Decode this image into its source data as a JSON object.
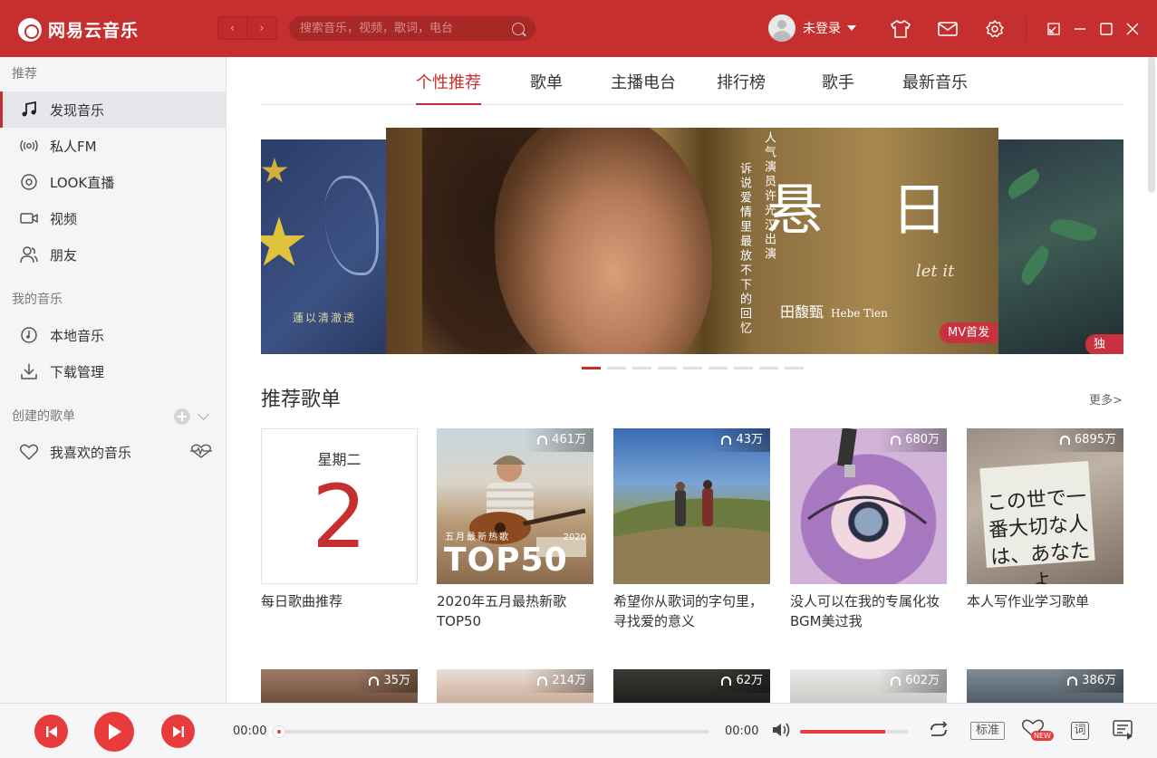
{
  "app": {
    "name": "网易云音乐"
  },
  "header": {
    "back_arrow": "‹",
    "forward_arrow": "›",
    "search_placeholder": "搜索音乐，视频，歌词，电台",
    "user_name": "未登录"
  },
  "sidebar": {
    "section1": "推荐",
    "items1": [
      {
        "label": "发现音乐",
        "icon": "music-note-icon",
        "active": true
      },
      {
        "label": "私人FM",
        "icon": "radio-waves-icon"
      },
      {
        "label": "LOOK直播",
        "icon": "live-icon"
      },
      {
        "label": "视频",
        "icon": "video-camera-icon"
      },
      {
        "label": "朋友",
        "icon": "friends-icon"
      }
    ],
    "section2": "我的音乐",
    "items2": [
      {
        "label": "本地音乐",
        "icon": "disc-icon"
      },
      {
        "label": "下载管理",
        "icon": "download-icon"
      }
    ],
    "section3": "创建的歌单",
    "items3": [
      {
        "label": "我喜欢的音乐",
        "icon": "heart-icon"
      }
    ]
  },
  "tabs": [
    "个性推荐",
    "歌单",
    "主播电台",
    "排行榜",
    "歌手",
    "最新音乐"
  ],
  "banner": {
    "left_caption": "蓮以清澈透",
    "vertical_1": "人气演员许光汉出演",
    "vertical_2": "诉说爱情里最放不下的回忆",
    "brush_title": "悬 日",
    "handwriting": "let it",
    "artist_cn": "田馥甄",
    "artist_en": "Hebe Tien",
    "tag_center": "MV首发",
    "tag_right": "独家",
    "dot_count": 9,
    "active_dot": 0
  },
  "playlists": {
    "title": "推荐歌单",
    "more": "更多>",
    "daily": {
      "weekday": "星期二",
      "day": "2",
      "title": "每日歌曲推荐"
    },
    "row1": [
      {
        "plays": "461万",
        "title": "2020年五月最热新歌TOP50",
        "cover_text": "TOP50",
        "cover_sub": "五月最新热歌",
        "cover_year": "2020"
      },
      {
        "plays": "43万",
        "title": "希望你从歌词的字句里，寻找爱的意义"
      },
      {
        "plays": "680万",
        "title": "没人可以在我的专属化妆BGM美过我"
      },
      {
        "plays": "6895万",
        "title": "本人写作业学习歌单",
        "cover_text": "この世で一番大切な人は、あなたよ"
      }
    ],
    "row2": [
      {
        "plays": "35万"
      },
      {
        "plays": "214万"
      },
      {
        "plays": "62万"
      },
      {
        "plays": "602万"
      },
      {
        "plays": "386万"
      }
    ]
  },
  "player": {
    "current_time": "00:00",
    "total_time": "00:00",
    "progress": 0,
    "volume": 0.78,
    "quality": "标准",
    "new_badge": "NEW",
    "lyric_label": "词"
  },
  "colors": {
    "brand": "#c62f2f",
    "accent": "#e83c3c"
  }
}
